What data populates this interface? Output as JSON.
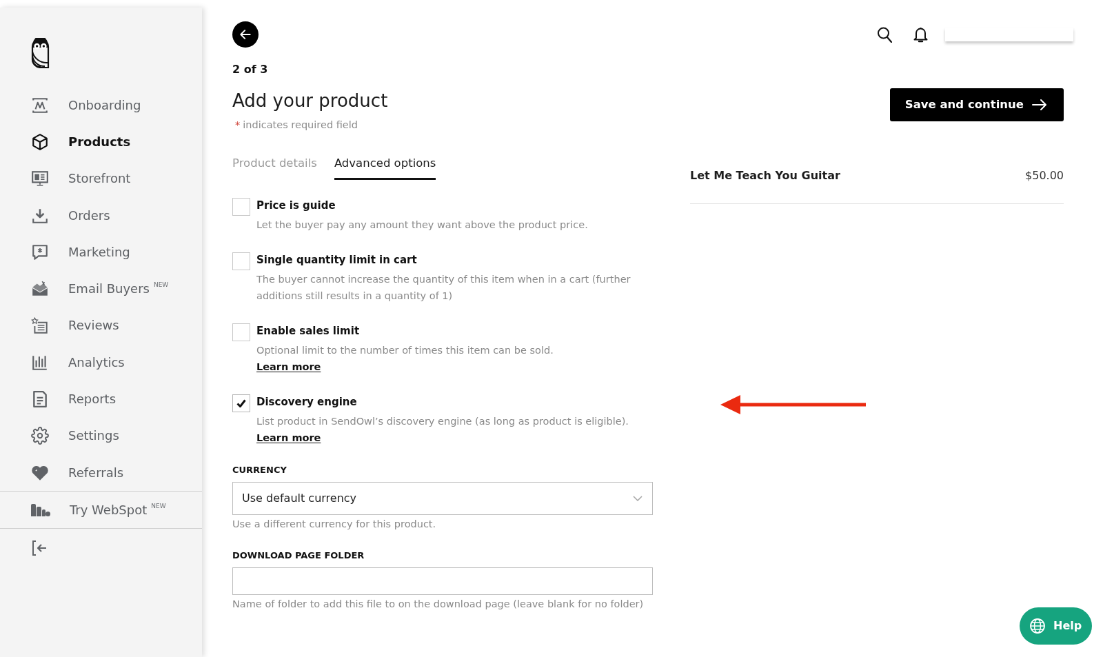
{
  "sidebar": {
    "items": [
      {
        "label": "Onboarding",
        "selected": false
      },
      {
        "label": "Products",
        "selected": true
      },
      {
        "label": "Storefront",
        "selected": false
      },
      {
        "label": "Orders",
        "selected": false
      },
      {
        "label": "Marketing",
        "selected": false
      },
      {
        "label": "Email Buyers",
        "badge": "NEW",
        "selected": false
      },
      {
        "label": "Reviews",
        "selected": false
      },
      {
        "label": "Analytics",
        "selected": false
      },
      {
        "label": "Reports",
        "selected": false
      },
      {
        "label": "Settings",
        "selected": false
      },
      {
        "label": "Referrals",
        "selected": false
      }
    ],
    "promo": {
      "label": "Try WebSpot",
      "badge": "NEW"
    }
  },
  "header": {
    "step": "2 of 3",
    "title": "Add your product",
    "required_note": {
      "mark": "*",
      "text": "indicates required field"
    }
  },
  "tabs": [
    {
      "label": "Product details",
      "selected": false
    },
    {
      "label": "Advanced options",
      "selected": true
    }
  ],
  "options": [
    {
      "label": "Price is guide",
      "checked": false,
      "description": "Let the buyer pay any amount they want above the product price."
    },
    {
      "label": "Single quantity limit in cart",
      "checked": false,
      "description": "The buyer cannot increase the quantity of this item when in a cart (further additions still results in a quantity of 1)"
    },
    {
      "label": "Enable sales limit",
      "checked": false,
      "description": "Optional limit to the number of times this item can be sold.",
      "link": "Learn more"
    },
    {
      "label": "Discovery engine",
      "checked": true,
      "description": "List product in SendOwl’s discovery engine (as long as product is eligible).",
      "link": "Learn more"
    }
  ],
  "fields": [
    {
      "kind": "select",
      "label": "CURRENCY",
      "value": "Use default currency",
      "hint": "Use a different currency for this product."
    },
    {
      "kind": "text",
      "label": "DOWNLOAD PAGE FOLDER",
      "hint": "Name of folder to add this file to on the download page (leave blank for no folder)"
    }
  ],
  "save_button": {
    "label": "Save and continue"
  },
  "summary": {
    "product": "Let Me Teach You Guitar",
    "price": "$50.00"
  },
  "help_button": {
    "label": "Help"
  }
}
